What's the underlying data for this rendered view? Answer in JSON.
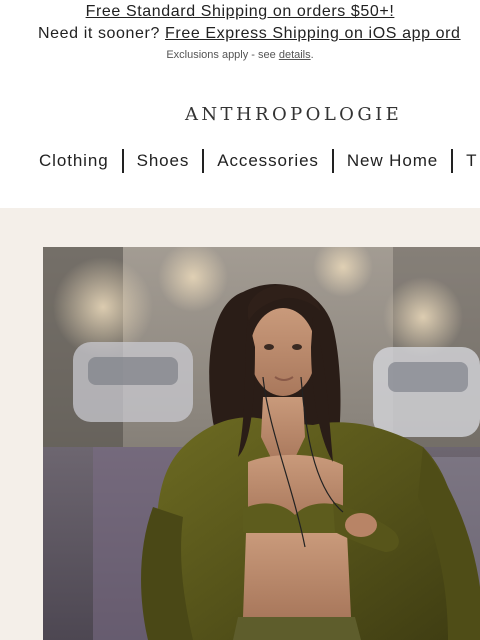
{
  "promo": {
    "line1_link": "Free Standard Shipping on orders $50+!",
    "line2_prefix": "Need it sooner?",
    "line2_link": "Free Express Shipping on iOS app ord",
    "line3_prefix": "Exclusions apply - see",
    "line3_link": "details",
    "line3_suffix": "."
  },
  "header": {
    "logo": "ANTHROPOLOGIE"
  },
  "nav": {
    "items": [
      {
        "label": "Clothing"
      },
      {
        "label": "Shoes"
      },
      {
        "label": "Accessories"
      },
      {
        "label": "New Home"
      },
      {
        "label": "T"
      }
    ]
  },
  "hero": {
    "image_description_icon": "hero-photo"
  },
  "colors": {
    "hero_background": "#f4efe9",
    "jacket": "#5c5a1c"
  }
}
